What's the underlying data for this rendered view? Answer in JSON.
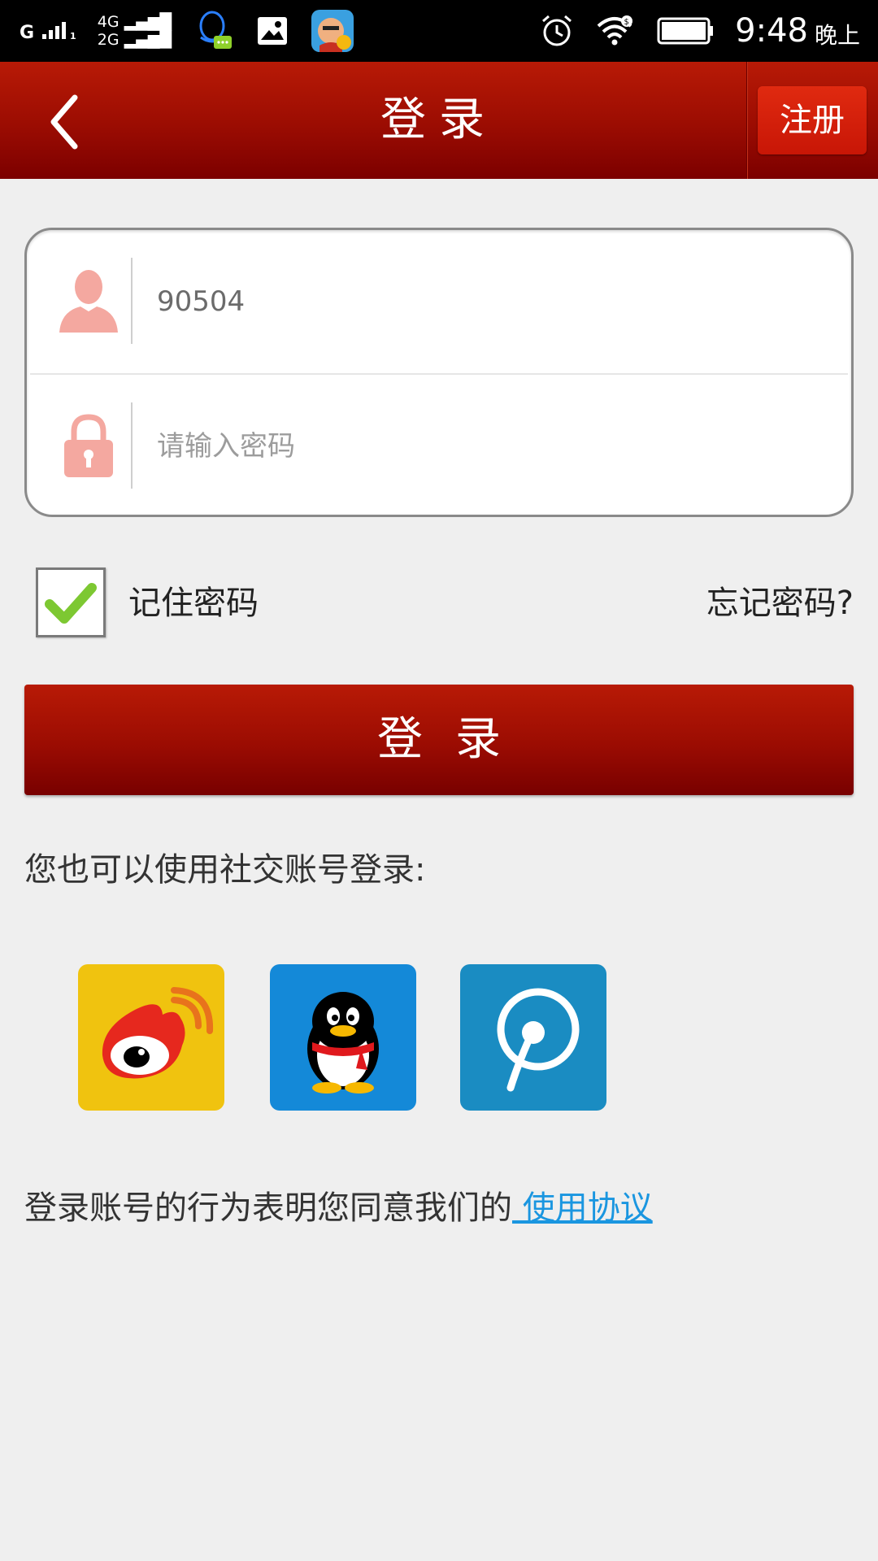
{
  "status_bar": {
    "signal1": "G",
    "signal2_top": "4G",
    "signal2_bottom": "2G",
    "time": "9:48",
    "ampm": "晚上"
  },
  "header": {
    "title": "登录",
    "register_label": "注册"
  },
  "form": {
    "username_value": "90504",
    "password_placeholder": "请输入密码"
  },
  "options": {
    "remember_label": "记住密码",
    "remember_checked": true,
    "forgot_label": "忘记密码?"
  },
  "login_button_label": "登录",
  "social": {
    "hint": "您也可以使用社交账号登录:",
    "providers": [
      "weibo-icon",
      "qq-icon",
      "p-icon"
    ]
  },
  "agreement": {
    "text": "登录账号的行为表明您同意我们的",
    "link": " 使用协议"
  }
}
